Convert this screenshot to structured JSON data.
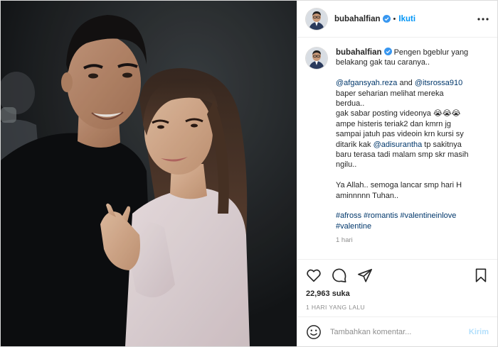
{
  "post": {
    "username": "bubahalfian",
    "follow_label": "Ikuti",
    "separator": "•",
    "caption_lines": [
      [
        {
          "t": "Pengen bgeblur yang",
          "k": "text"
        }
      ],
      [
        {
          "t": "belakang gak tau caranya..",
          "k": "text"
        }
      ],
      [],
      [
        {
          "t": "@afgansyah.reza",
          "k": "mention"
        },
        {
          "t": " and ",
          "k": "text"
        },
        {
          "t": "@itsrossa910",
          "k": "mention"
        }
      ],
      [
        {
          "t": "baper seharian melihat mereka",
          "k": "text"
        }
      ],
      [
        {
          "t": "berdua..",
          "k": "text"
        }
      ],
      [
        {
          "t": "gak sabar posting videonya 😭😭😭",
          "k": "text"
        }
      ],
      [
        {
          "t": "ampe histeris teriak2 dan kmrn jg",
          "k": "text"
        }
      ],
      [
        {
          "t": "sampai jatuh pas videoin krn kursi sy",
          "k": "text"
        }
      ],
      [
        {
          "t": "ditarik kak ",
          "k": "text"
        },
        {
          "t": "@adisurantha",
          "k": "mention"
        },
        {
          "t": " tp sakitnya",
          "k": "text"
        }
      ],
      [
        {
          "t": "baru terasa tadi malam smp skr masih",
          "k": "text"
        }
      ],
      [
        {
          "t": "ngilu..",
          "k": "text"
        }
      ],
      [],
      [
        {
          "t": "Ya Allah.. semoga lancar smp hari H",
          "k": "text"
        }
      ],
      [
        {
          "t": "aminnnnn Tuhan..",
          "k": "text"
        }
      ],
      [],
      [
        {
          "t": "#afross",
          "k": "tag"
        },
        {
          "t": " ",
          "k": "text"
        },
        {
          "t": "#romantis",
          "k": "tag"
        },
        {
          "t": " ",
          "k": "text"
        },
        {
          "t": "#valentineinlove",
          "k": "tag"
        }
      ],
      [
        {
          "t": "#valentine",
          "k": "tag"
        }
      ]
    ],
    "time_ago": "1 hari",
    "likes": "22,963 suka",
    "date": "1 HARI YANG LALU",
    "comment_placeholder": "Tambahkan komentar...",
    "send_label": "Kirim"
  },
  "icons": {
    "verified": "verified-badge-icon",
    "more": "more-options-icon",
    "like": "heart-icon",
    "comment": "comment-icon",
    "share": "share-icon",
    "save": "bookmark-icon",
    "emoji": "emoji-icon"
  },
  "colors": {
    "link": "#00376b",
    "follow": "#0095f6",
    "verified": "#3897f0",
    "muted": "#8e8e8e",
    "send_disabled": "#b2dffc"
  }
}
